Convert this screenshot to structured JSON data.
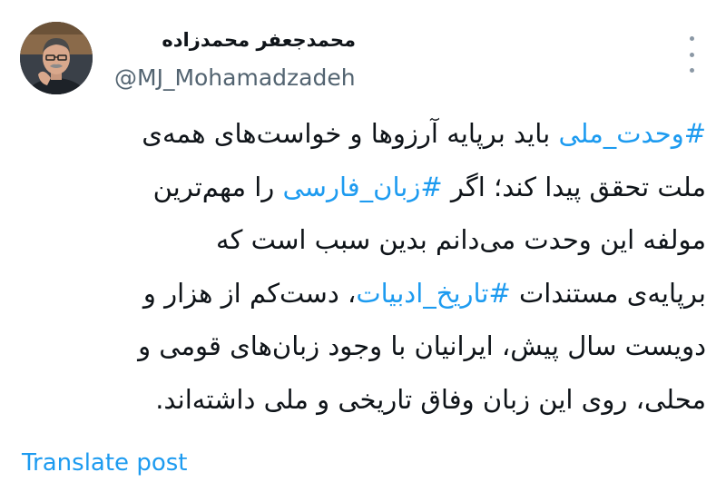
{
  "author": {
    "display_name": "محمدجعفر محمدزاده",
    "handle": "@MJ_Mohamadzadeh",
    "avatar_icon": "profile-photo"
  },
  "more_icon": "more-vertical-icon",
  "tweet": {
    "lines": [
      [
        {
          "text": "#وحدت_ملی",
          "type": "hashtag"
        },
        {
          "text": " باید برپایه آرزوها و خواست‌های همه‌ی",
          "type": "text"
        }
      ],
      [
        {
          "text": "ملت تحقق پیدا کند؛ اگر ",
          "type": "text"
        },
        {
          "text": "#زبان_فارسی",
          "type": "hashtag"
        },
        {
          "text": " را مهم‌ترین",
          "type": "text"
        }
      ],
      [
        {
          "text": "مولفه این وحدت می‌دانم بدین سبب است که",
          "type": "text"
        }
      ],
      [
        {
          "text": "برپایه‌ی مستندات ",
          "type": "text"
        },
        {
          "text": "#تاریخ_ادبیات",
          "type": "hashtag"
        },
        {
          "text": "، دست‌کم از هزار و",
          "type": "text"
        }
      ],
      [
        {
          "text": "دویست سال پیش، ایرانیان با وجود زبان‌های قومی و",
          "type": "text"
        }
      ],
      [
        {
          "text": "محلی، روی این زبان وفاق تاریخی و ملی داشته‌اند.",
          "type": "text"
        }
      ]
    ]
  },
  "translate_label": "Translate post",
  "colors": {
    "link": "#1d9bf0",
    "text": "#0f1419",
    "secondary": "#536471",
    "icon": "#8b98a5"
  }
}
